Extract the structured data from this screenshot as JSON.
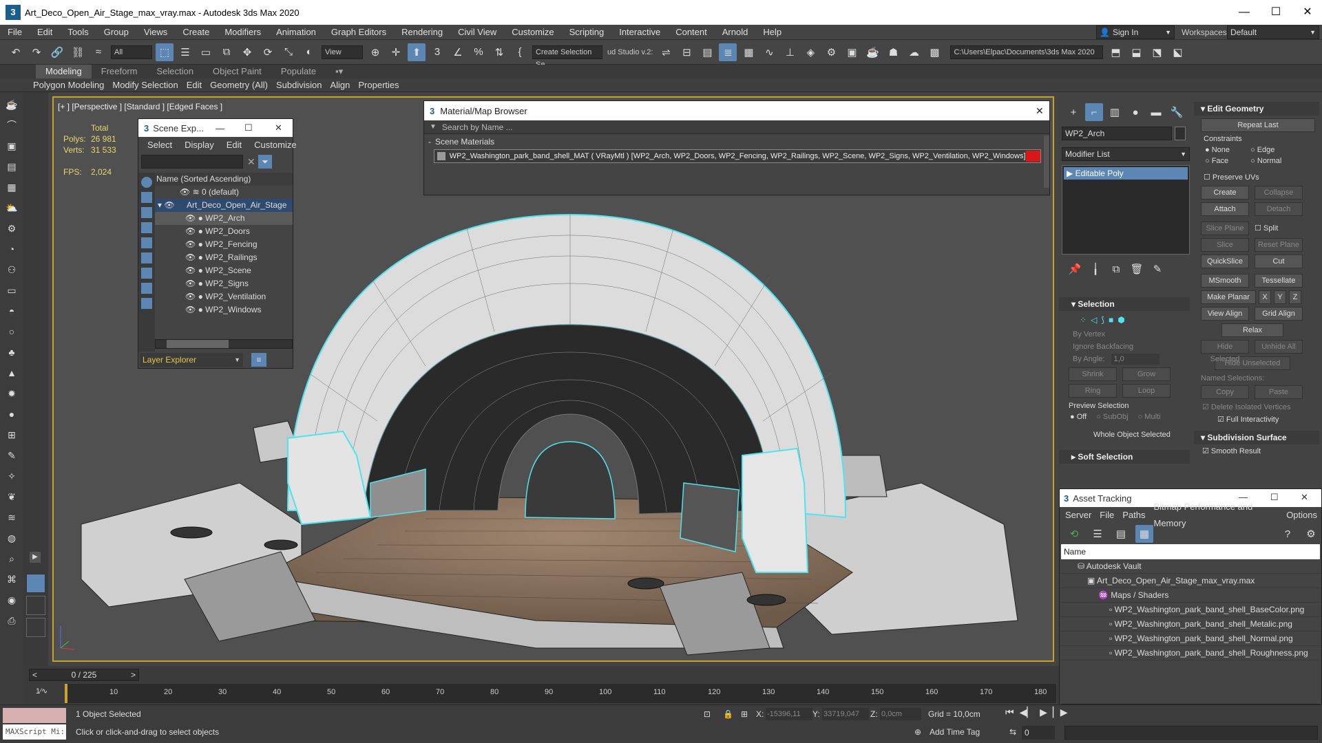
{
  "title": {
    "text": "Art_Deco_Open_Air_Stage_max_vray.max - Autodesk 3ds Max 2020"
  },
  "window_controls": {
    "minimize": "—",
    "maximize": "☐",
    "close": "✕"
  },
  "menu": [
    "File",
    "Edit",
    "Tools",
    "Group",
    "Views",
    "Create",
    "Modifiers",
    "Animation",
    "Graph Editors",
    "Rendering",
    "Civil View",
    "Customize",
    "Scripting",
    "Interactive",
    "Content",
    "Arnold",
    "Help"
  ],
  "account": {
    "sign_in": "Sign In",
    "workspaces_label": "Workspaces:",
    "workspace": "Default"
  },
  "toolbar": {
    "filter": "All",
    "view": "View",
    "selection_set": "Create Selection Se",
    "studio": "ud Studio v.2:",
    "path": "C:\\Users\\Elpac\\Documents\\3ds Max 2020"
  },
  "ribbon": {
    "tabs": [
      "Modeling",
      "Freeform",
      "Selection",
      "Object Paint",
      "Populate"
    ],
    "panels": [
      "Polygon Modeling",
      "Modify Selection",
      "Edit",
      "Geometry (All)",
      "Subdivision",
      "Align",
      "Properties"
    ]
  },
  "viewport": {
    "label": "[+ ] [Perspective ] [Standard ] [Edged Faces ]",
    "stats": {
      "total": "Total",
      "polys_label": "Polys:",
      "polys": "26 981",
      "verts_label": "Verts:",
      "verts": "31 533",
      "fps_label": "FPS:",
      "fps": "2,024"
    }
  },
  "scene_explorer": {
    "title": "Scene Exp...",
    "menu": [
      "Select",
      "Display",
      "Edit",
      "Customize"
    ],
    "column": "Name (Sorted Ascending)",
    "rows": [
      "0 (default)",
      "Art_Deco_Open_Air_Stage",
      "WP2_Arch",
      "WP2_Doors",
      "WP2_Fencing",
      "WP2_Railings",
      "WP2_Scene",
      "WP2_Signs",
      "WP2_Ventilation",
      "WP2_Windows"
    ],
    "footer": "Layer Explorer"
  },
  "material_browser": {
    "title": "Material/Map Browser",
    "search_placeholder": "Search by Name ...",
    "section": "Scene Materials",
    "item": "WP2_Washington_park_band_shell_MAT  ( VRayMtl ) [WP2_Arch, WP2_Doors, WP2_Fencing, WP2_Railings, WP2_Scene, WP2_Signs, WP2_Ventilation, WP2_Windows]"
  },
  "command_panel": {
    "object_name": "WP2_Arch",
    "modifier_list": "Modifier List",
    "stack_item": "Editable Poly",
    "edit_geometry": "Edit Geometry",
    "repeat_last": "Repeat Last",
    "constraints": "Constraints",
    "c_none": "None",
    "c_edge": "Edge",
    "c_face": "Face",
    "c_normal": "Normal",
    "preserve_uvs": "Preserve UVs",
    "create": "Create",
    "collapse": "Collapse",
    "attach": "Attach",
    "detach": "Detach",
    "slice_plane": "Slice Plane",
    "split": "Split",
    "slice": "Slice",
    "reset_plane": "Reset Plane",
    "quickslice": "QuickSlice",
    "cut": "Cut",
    "msmooth": "MSmooth",
    "tessellate": "Tessellate",
    "make_planar": "Make Planar",
    "x": "X",
    "y": "Y",
    "z": "Z",
    "view_align": "View Align",
    "grid_align": "Grid Align",
    "relax": "Relax",
    "hide_selected": "Hide Selected",
    "unhide_all": "Unhide All",
    "hide_unselected": "Hide Unselected",
    "named_selections": "Named Selections:",
    "copy": "Copy",
    "paste": "Paste",
    "delete_isolated": "Delete Isolated Vertices",
    "full_interactivity": "Full Interactivity",
    "subdivision_surface": "Subdivision Surface",
    "smooth_result": "Smooth Result",
    "selection": "Selection",
    "by_vertex": "By Vertex",
    "ignore_backfacing": "Ignore Backfacing",
    "by_angle": "By Angle:",
    "angle_value": "1,0",
    "shrink": "Shrink",
    "grow": "Grow",
    "ring": "Ring",
    "loop": "Loop",
    "preview_selection": "Preview Selection",
    "p_off": "Off",
    "p_subobj": "SubObj",
    "p_multi": "Multi",
    "whole_object": "Whole Object Selected",
    "soft_selection": "Soft Selection"
  },
  "asset_tracking": {
    "title": "Asset Tracking",
    "menu": [
      "Server",
      "File",
      "Paths",
      "Bitmap Performance and Memory",
      "Options"
    ],
    "column": "Name",
    "rows": [
      "Autodesk Vault",
      "Art_Deco_Open_Air_Stage_max_vray.max",
      "Maps / Shaders",
      "WP2_Washington_park_band_shell_BaseColor.png",
      "WP2_Washington_park_band_shell_Metalic.png",
      "WP2_Washington_park_band_shell_Normal.png",
      "WP2_Washington_park_band_shell_Roughness.png"
    ]
  },
  "timeline": {
    "frame": "0 / 225",
    "ticks": [
      "10",
      "20",
      "30",
      "40",
      "50",
      "60",
      "70",
      "80",
      "90",
      "100",
      "110",
      "120",
      "130",
      "140",
      "150",
      "160",
      "170",
      "180"
    ]
  },
  "status": {
    "maxscript": "MAXScript Mi:",
    "selected": "1 Object Selected",
    "hint": "Click or click-and-drag to select objects",
    "x_label": "X:",
    "x": "-15396,11",
    "y_label": "Y:",
    "y": "33719,047",
    "z_label": "Z:",
    "z": "0,0cm",
    "grid": "Grid = 10,0cm",
    "add_time_tag": "Add Time Tag",
    "frame_field": "0"
  },
  "colors": {
    "accent": "#5c87b5",
    "viewport_border": "#c7a32c",
    "stats": "#e8d86a",
    "selection_cyan": "#4fe3f0"
  }
}
